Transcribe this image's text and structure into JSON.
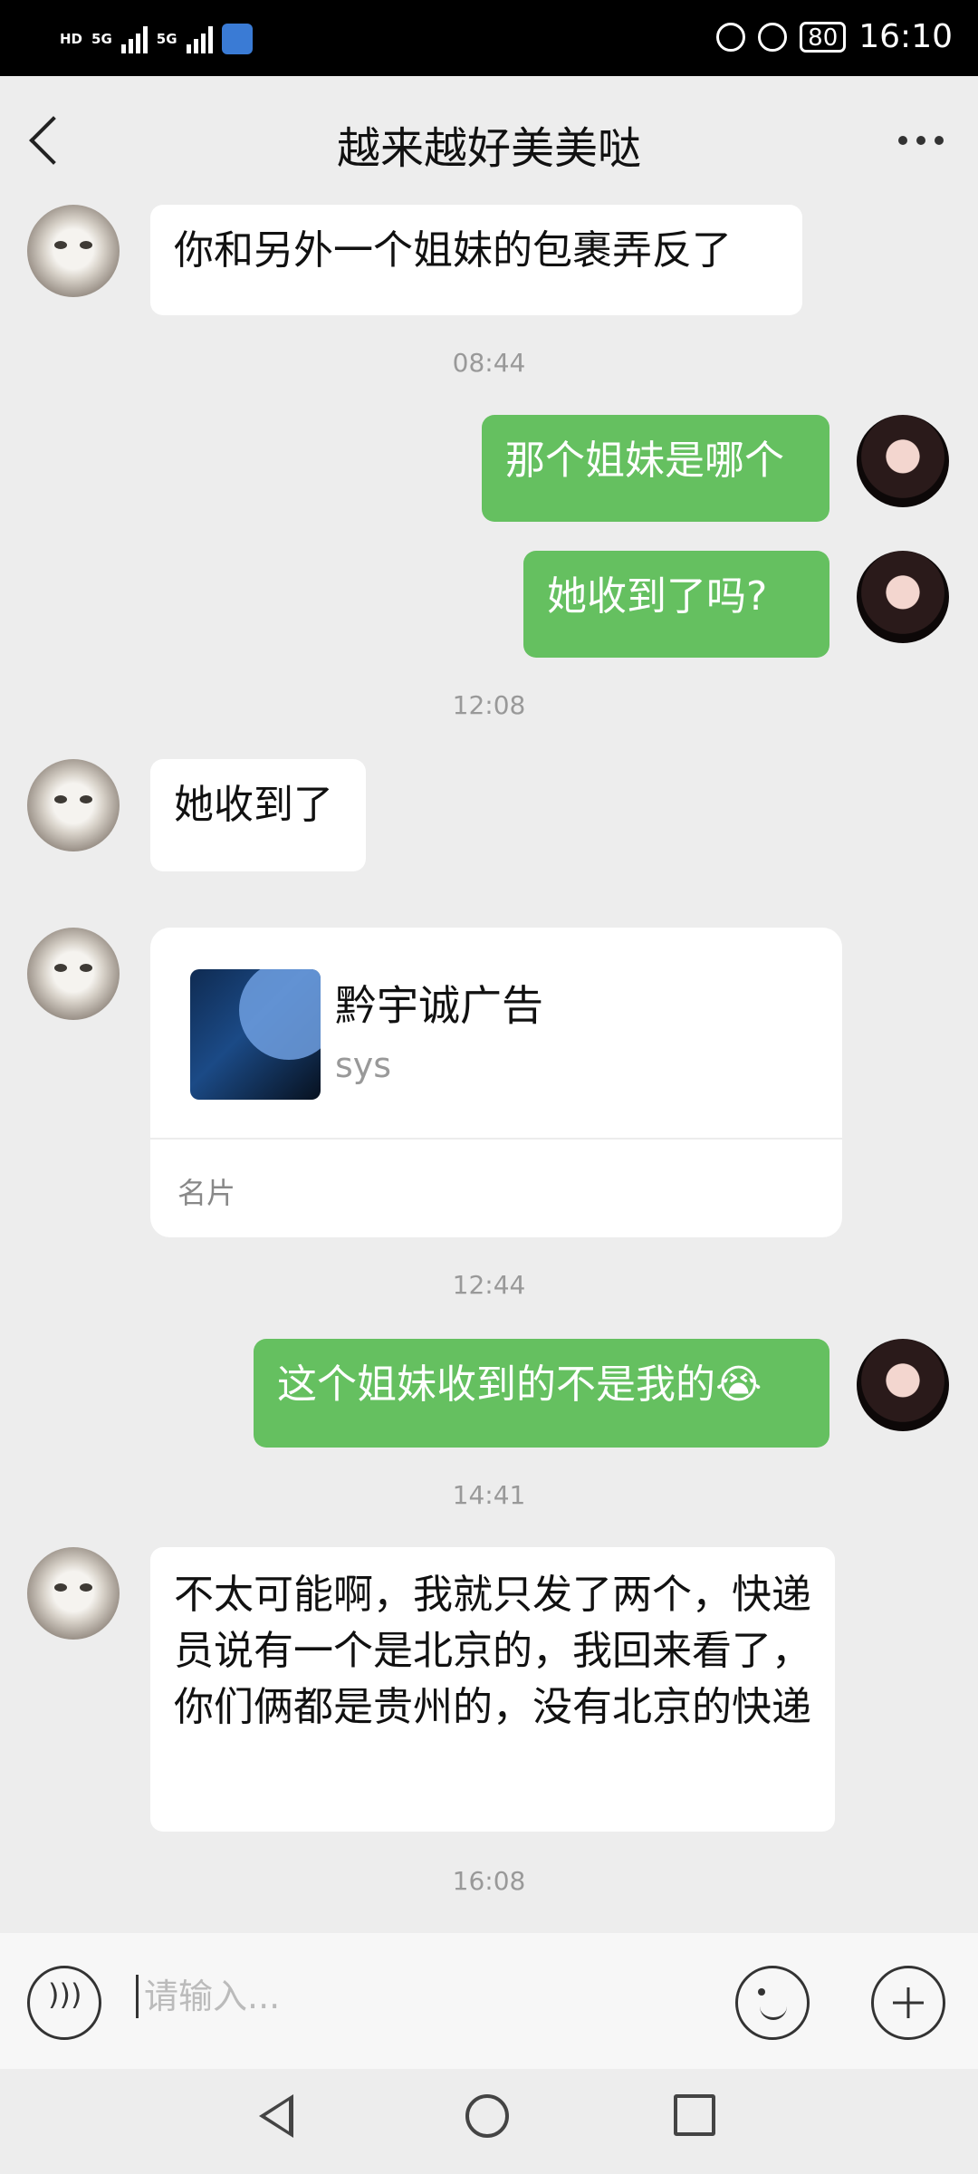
{
  "status_bar": {
    "left_small_labels": [
      "HD",
      "5G",
      "5G"
    ],
    "battery": "80",
    "time": "16:10"
  },
  "header": {
    "title": "越来越好美美哒"
  },
  "messages": [
    {
      "side": "in",
      "text": "你和另外一个姐妹的包裹弄反了"
    },
    {
      "timestamp": "08:44"
    },
    {
      "side": "out",
      "text": "那个姐妹是哪个"
    },
    {
      "side": "out",
      "text": "她收到了吗?"
    },
    {
      "timestamp": "12:08"
    },
    {
      "side": "in",
      "text": "她收到了"
    },
    {
      "side": "in",
      "type": "card",
      "name": "黔宇诚广告",
      "subtitle": "sys",
      "label": "名片"
    },
    {
      "timestamp": "12:44"
    },
    {
      "side": "out",
      "text": "这个姐妹收到的不是我的😭"
    },
    {
      "timestamp": "14:41"
    },
    {
      "side": "in",
      "text": "不太可能啊，我就只发了两个，快递员说有一个是北京的，我回来看了，你们俩都是贵州的，没有北京的快递"
    },
    {
      "timestamp": "16:08"
    }
  ],
  "composer": {
    "placeholder": "请输入..."
  },
  "icons": {
    "back": "chevron-left-icon",
    "more": "more-dots-icon",
    "voice": "voice-icon",
    "emoji": "emoji-icon",
    "plus": "plus-icon"
  },
  "colors": {
    "outgoing_bubble": "#65c060",
    "incoming_bubble": "#ffffff",
    "background": "#ededed"
  }
}
